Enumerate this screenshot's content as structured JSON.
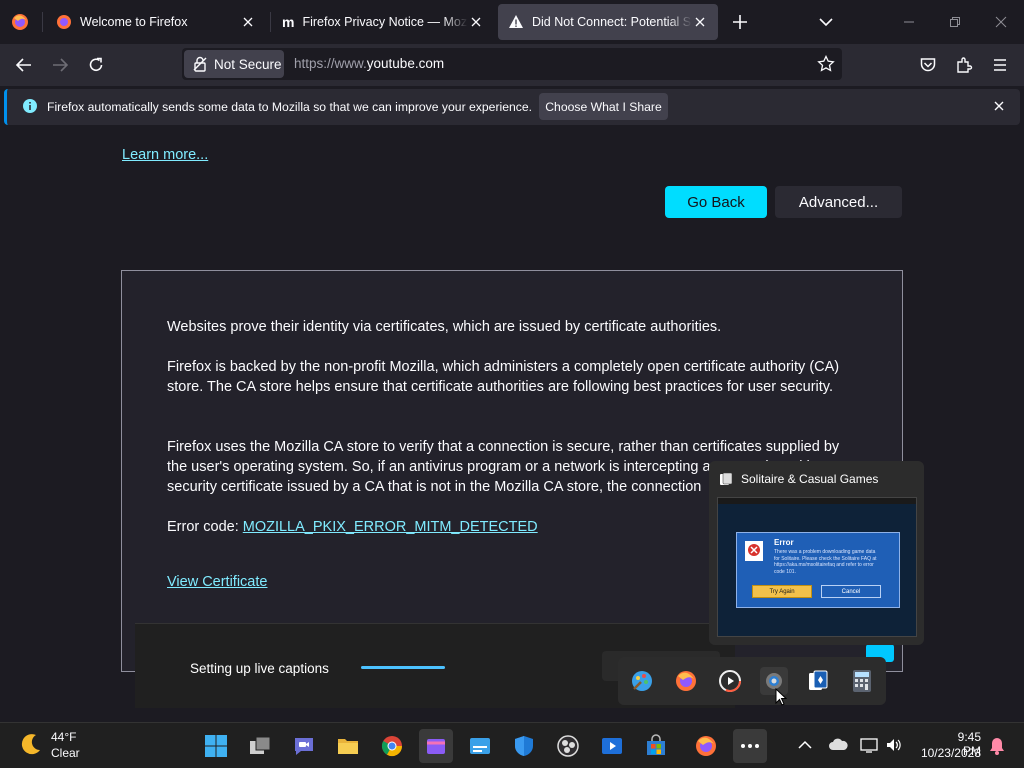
{
  "tabs": [
    {
      "title": "Welcome to Firefox"
    },
    {
      "title": "Firefox Privacy Notice — Mozilla"
    },
    {
      "title": "Did Not Connect: Potential Security Issue"
    }
  ],
  "nav": {
    "not_secure_label": "Not Secure",
    "url_prefix": "https://www.",
    "url_domain": "youtube.com"
  },
  "notification": {
    "text": "Firefox automatically sends some data to Mozilla so that we can improve your experience.",
    "button": "Choose What I Share"
  },
  "page": {
    "learn_more": "Learn more...",
    "go_back": "Go Back",
    "advanced": "Advanced...",
    "para1": "Websites prove their identity via certificates, which are issued by certificate authorities.",
    "para2": "Firefox is backed by the non-profit Mozilla, which administers a completely open certificate authority (CA) store. The CA store helps ensure that certificate authorities are following best practices for user security.",
    "para3": "Firefox uses the Mozilla CA store to verify that a connection is secure, rather than certificates supplied by the user's operating system. So, if an antivirus program or a network is intercepting a connection with a security certificate issued by a CA that is not in the Mozilla CA store, the connection",
    "error_label": "Error code: ",
    "error_code": "MOZILLA_PKIX_ERROR_MITM_DETECTED",
    "view_cert": "View Certificate"
  },
  "captions": {
    "text": "Setting up live captions",
    "progress": 0.5
  },
  "preview": {
    "title": "Solitaire & Casual Games",
    "dialog_title": "Error",
    "dialog_body": "There was a problem downloading game data for Solitaire. Please check the Solitaire FAQ at https://aka.ms/msolitairefaq and refer to error code 101.",
    "try_again": "Try Again",
    "cancel": "Cancel"
  },
  "taskbar": {
    "weather_temp": "44°F",
    "weather_cond": "Clear",
    "time": "9:45 PM",
    "date": "10/23/2023"
  },
  "colors": {
    "accent": "#00ddff",
    "link": "#80ebff",
    "bg": "#1c1b22",
    "toolbar": "#2b2a33"
  }
}
